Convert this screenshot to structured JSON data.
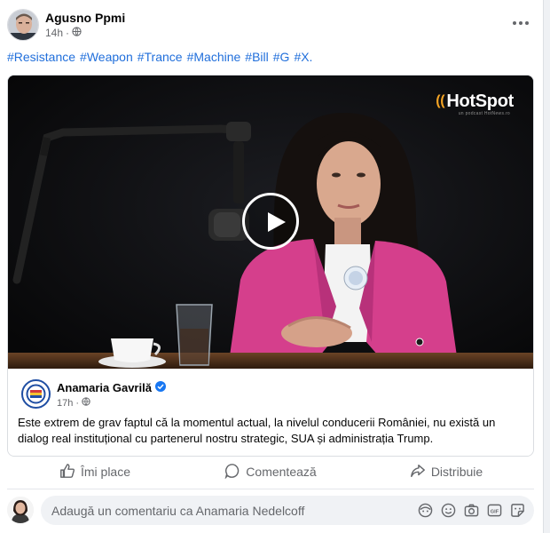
{
  "post": {
    "author": "Agusno Ppmi",
    "time": "14h",
    "hashtags": [
      "#Resistance",
      "#Weapon",
      "#Trance",
      "#Machine",
      "#Bill",
      "#G",
      "#X."
    ]
  },
  "video": {
    "logo": "HotSpot",
    "logo_waves": "((",
    "logo_sub": "un podcast HotNews.ro"
  },
  "shared": {
    "page_name": "Anamaria Gavrilă",
    "time": "17h",
    "text": "Este extrem de grav faptul că la momentul actual, la nivelul conducerii României, nu există un dialog real instituțional cu partenerul nostru strategic, SUA și administrația Trump."
  },
  "actions": {
    "like": "Îmi place",
    "comment": "Comentează",
    "share": "Distribuie"
  },
  "composer": {
    "placeholder": "Adaugă un comentariu ca Anamaria Nedelcoff"
  },
  "colors": {
    "hashtag": "#216fdb",
    "verified": "#1877f2",
    "logo_accent": "#f3a324",
    "jacket": "#d53f8c"
  },
  "icons": [
    "globe-icon",
    "more-icon",
    "play-icon",
    "verified-icon",
    "like-icon",
    "comment-icon",
    "share-icon",
    "avatar-sticker-icon",
    "emoji-icon",
    "camera-icon",
    "gif-icon",
    "sticker-icon"
  ]
}
